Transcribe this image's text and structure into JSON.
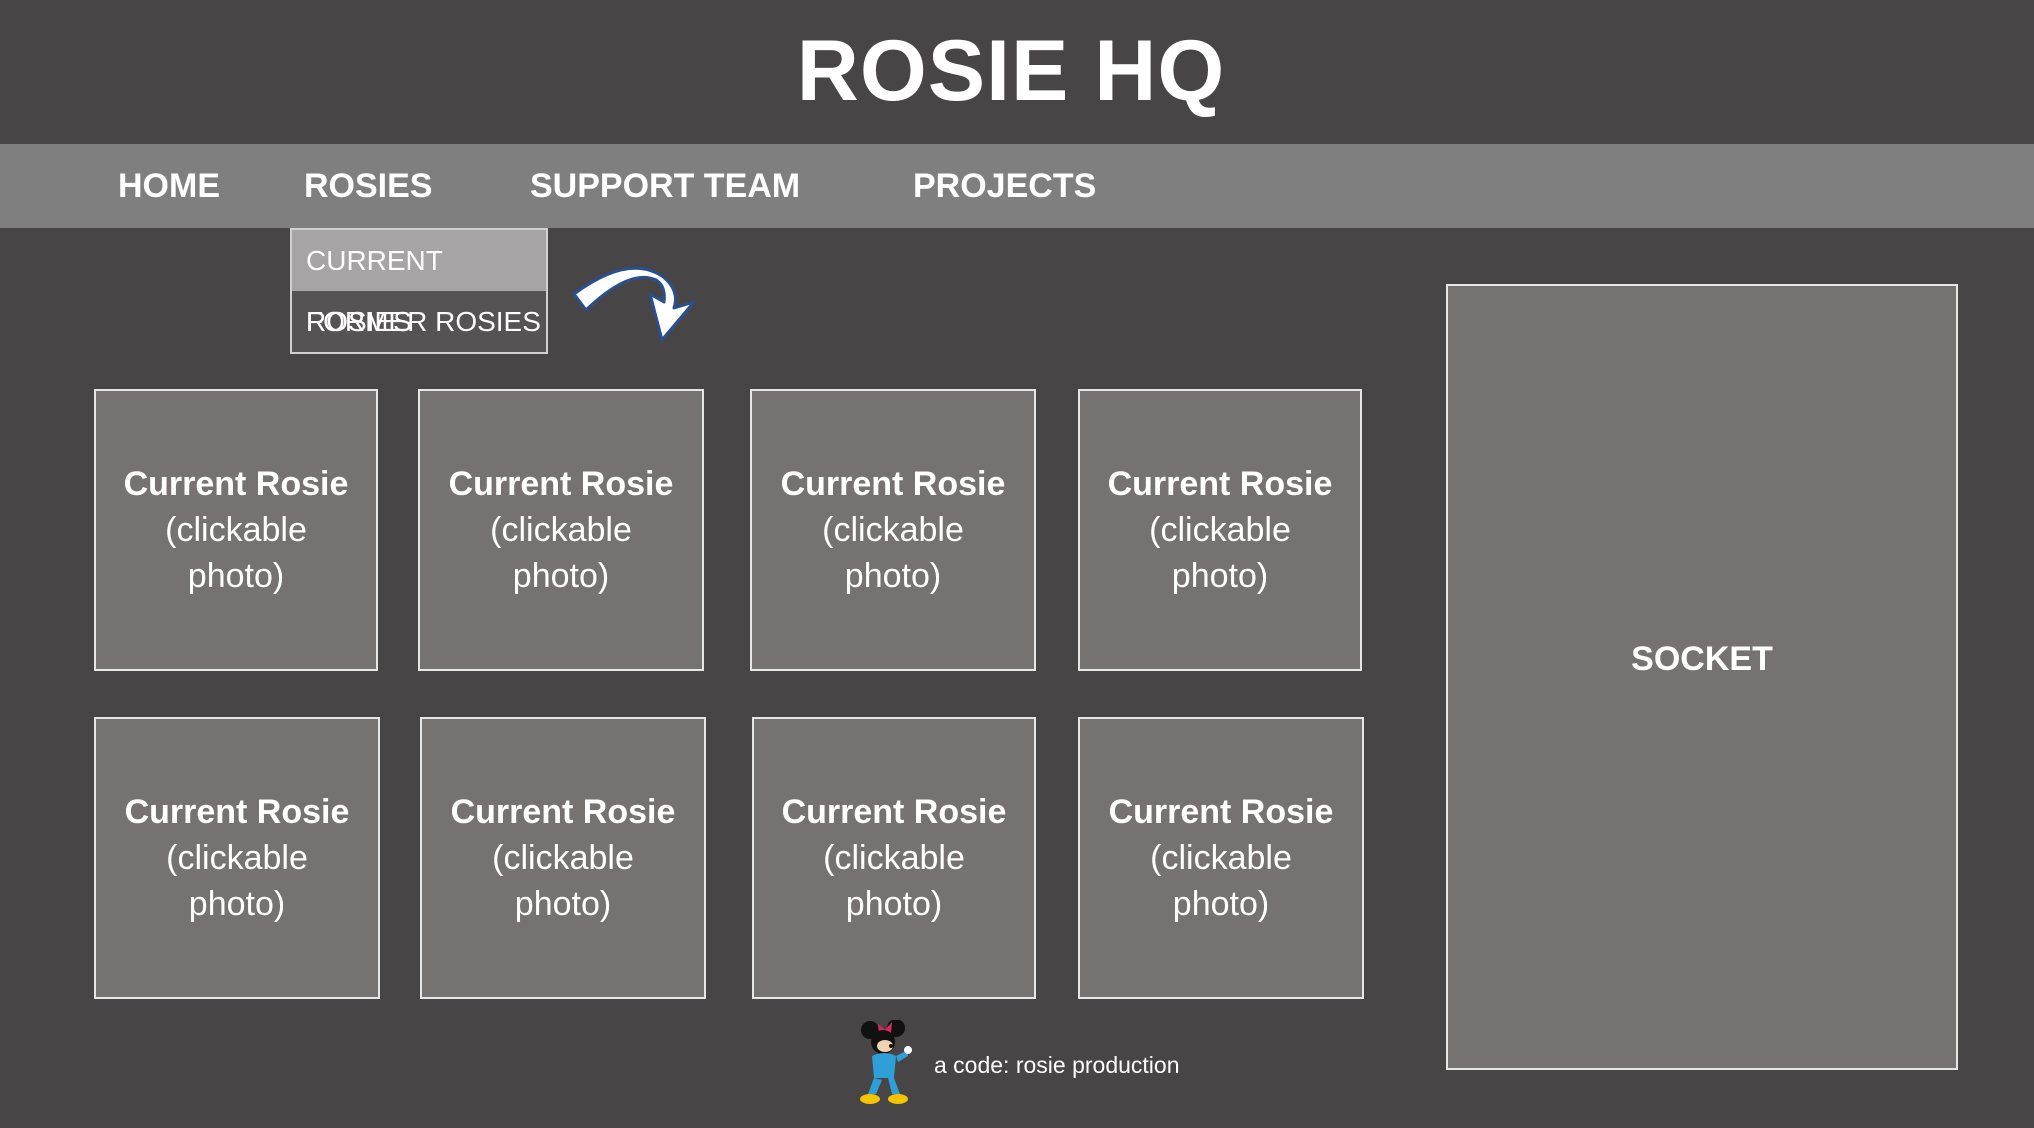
{
  "header": {
    "title": "ROSIE HQ"
  },
  "nav": {
    "items": [
      {
        "label": "HOME"
      },
      {
        "label": "ROSIES"
      },
      {
        "label": "SUPPORT TEAM"
      },
      {
        "label": "PROJECTS"
      }
    ]
  },
  "dropdown": {
    "items": [
      {
        "label": "CURRENT ROSIES",
        "active": true
      },
      {
        "label": "FORMER ROSIES",
        "active": false
      }
    ]
  },
  "tiles": [
    {
      "name": "Current Rosie",
      "line2": "(clickable",
      "line3": "photo)"
    },
    {
      "name": "Current Rosie",
      "line2": "(clickable",
      "line3": "photo)"
    },
    {
      "name": "Current Rosie",
      "line2": "(clickable",
      "line3": "photo)"
    },
    {
      "name": "Current Rosie",
      "line2": "(clickable",
      "line3": "photo)"
    },
    {
      "name": "Current Rosie",
      "line2": "(clickable",
      "line3": "photo)"
    },
    {
      "name": "Current Rosie",
      "line2": "(clickable",
      "line3": "photo)"
    },
    {
      "name": "Current Rosie",
      "line2": "(clickable",
      "line3": "photo)"
    },
    {
      "name": "Current Rosie",
      "line2": "(clickable",
      "line3": "photo)"
    }
  ],
  "socket": {
    "label": "SOCKET"
  },
  "footer": {
    "credit": "a code: rosie production",
    "mascot_icon": "minnie-mouse-icon"
  },
  "colors": {
    "background": "#474546",
    "navbar": "#7f7f7f",
    "tile": "#767271",
    "dropdown_active": "#a6a4a5",
    "text": "#ffffff"
  }
}
